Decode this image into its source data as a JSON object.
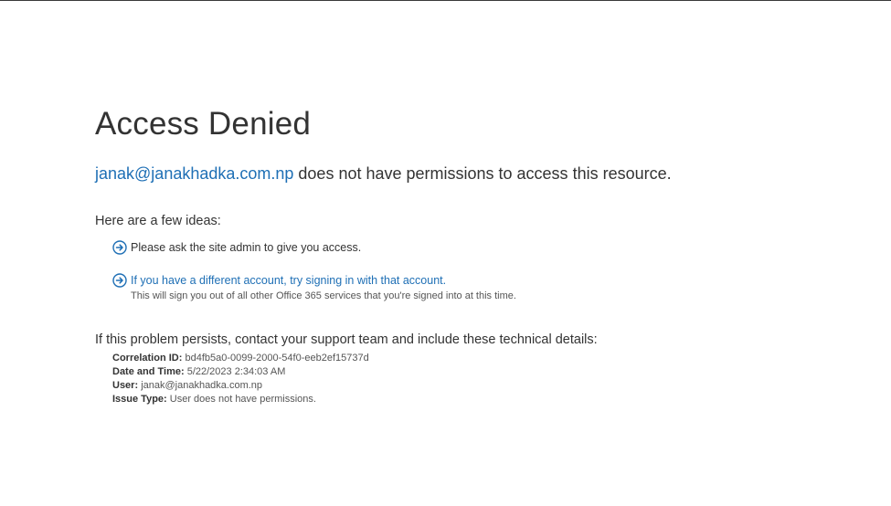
{
  "page": {
    "title": "Access Denied",
    "user_email": "janak@janakhadka.com.np",
    "permission_message": " does not have permissions to access this resource."
  },
  "ideas": {
    "heading": "Here are a few ideas:",
    "items": [
      {
        "text": "Please ask the site admin to give you access.",
        "icon": "arrow-right-circle-icon"
      },
      {
        "link_text": "If you have a different account, try signing in with that account.",
        "subnote": "This will sign you out of all other Office 365 services that you're signed into at this time.",
        "icon": "arrow-right-circle-icon"
      }
    ]
  },
  "technical": {
    "heading": "If this problem persists, contact your support team and include these technical details:",
    "details": [
      {
        "label": "Correlation ID:",
        "value": "bd4fb5a0-0099-2000-54f0-eeb2ef15737d"
      },
      {
        "label": "Date and Time:",
        "value": "5/22/2023 2:34:03 AM"
      },
      {
        "label": "User:",
        "value": "janak@janakhadka.com.np"
      },
      {
        "label": "Issue Type:",
        "value": "User does not have permissions."
      }
    ]
  },
  "colors": {
    "link": "#1e6fb5",
    "text": "#333333",
    "muted": "#555555"
  }
}
